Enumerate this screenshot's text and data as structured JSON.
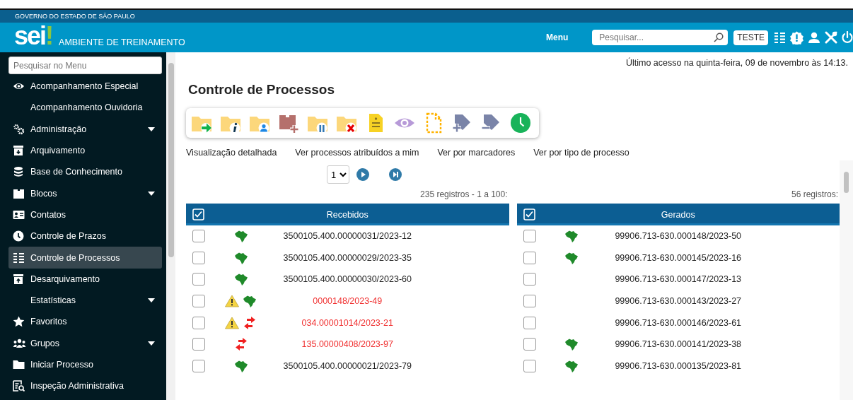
{
  "header": {
    "government": "GOVERNO DO ESTADO DE SÃO PAULO",
    "logo_text": "sei",
    "logo_mark": "!",
    "environment": "AMBIENTE DE TREINAMENTO",
    "menu_label": "Menu",
    "search_placeholder": "Pesquisar...",
    "unit": "TESTE"
  },
  "sidebar": {
    "search_placeholder": "Pesquisar no Menu",
    "items": [
      {
        "label": "Acompanhamento Especial",
        "submenu": false,
        "selected": false
      },
      {
        "label": "Acompanhamento Ouvidoria",
        "submenu": false,
        "selected": false
      },
      {
        "label": "Administração",
        "submenu": true,
        "selected": false
      },
      {
        "label": "Arquivamento",
        "submenu": false,
        "selected": false
      },
      {
        "label": "Base de Conhecimento",
        "submenu": false,
        "selected": false
      },
      {
        "label": "Blocos",
        "submenu": true,
        "selected": false
      },
      {
        "label": "Contatos",
        "submenu": false,
        "selected": false
      },
      {
        "label": "Controle de Prazos",
        "submenu": false,
        "selected": false
      },
      {
        "label": "Controle de Processos",
        "submenu": false,
        "selected": true
      },
      {
        "label": "Desarquivamento",
        "submenu": false,
        "selected": false
      },
      {
        "label": "Estatísticas",
        "submenu": true,
        "selected": false
      },
      {
        "label": "Favoritos",
        "submenu": false,
        "selected": false
      },
      {
        "label": "Grupos",
        "submenu": true,
        "selected": false
      },
      {
        "label": "Iniciar Processo",
        "submenu": false,
        "selected": false
      },
      {
        "label": "Inspeção Administrativa",
        "submenu": false,
        "selected": false
      }
    ]
  },
  "main": {
    "last_access": "Último acesso na quinta-feira, 09 de novembro às 14:13.",
    "title": "Controle de Processos",
    "view_links": [
      "Visualização detalhada",
      "Ver processos atribuídos a mim",
      "Ver por marcadores",
      "Ver por tipo de processo"
    ],
    "page": "1"
  },
  "tables": [
    {
      "count": "235 registros - 1 a 100:",
      "title": "Recebidos",
      "rows": [
        {
          "checked": false,
          "warning": false,
          "kind": "map",
          "number": "3500105.400.00000031/2023-12",
          "alert": false
        },
        {
          "checked": false,
          "warning": false,
          "kind": "map",
          "number": "3500105.400.00000029/2023-35",
          "alert": false
        },
        {
          "checked": false,
          "warning": false,
          "kind": "map",
          "number": "3500105.400.00000030/2023-60",
          "alert": false
        },
        {
          "checked": false,
          "warning": true,
          "kind": "map",
          "number": "0000148/2023-49",
          "alert": true
        },
        {
          "checked": false,
          "warning": true,
          "kind": "transfer",
          "number": "034.00001014/2023-21",
          "alert": true
        },
        {
          "checked": false,
          "warning": false,
          "kind": "transfer",
          "number": "135.00000408/2023-97",
          "alert": true
        },
        {
          "checked": false,
          "warning": false,
          "kind": "map",
          "number": "3500105.400.00000021/2023-79",
          "alert": false
        }
      ]
    },
    {
      "count": "56 registros:",
      "title": "Gerados",
      "rows": [
        {
          "checked": false,
          "warning": false,
          "kind": "map",
          "number": "99906.713-630.000148/2023-50",
          "alert": false
        },
        {
          "checked": false,
          "warning": false,
          "kind": "map",
          "number": "99906.713-630.000145/2023-16",
          "alert": false
        },
        {
          "checked": false,
          "warning": false,
          "kind": "plain",
          "number": "99906.713-630.000147/2023-13",
          "alert": false
        },
        {
          "checked": false,
          "warning": false,
          "kind": "plain",
          "number": "99906.713-630.000143/2023-27",
          "alert": false
        },
        {
          "checked": false,
          "warning": false,
          "kind": "plain",
          "number": "99906.713-630.000146/2023-61",
          "alert": false
        },
        {
          "checked": false,
          "warning": false,
          "kind": "map",
          "number": "99906.713-630.000141/2023-38",
          "alert": false
        },
        {
          "checked": false,
          "warning": false,
          "kind": "map",
          "number": "99906.713-630.000135/2023-81",
          "alert": false
        }
      ]
    }
  ]
}
